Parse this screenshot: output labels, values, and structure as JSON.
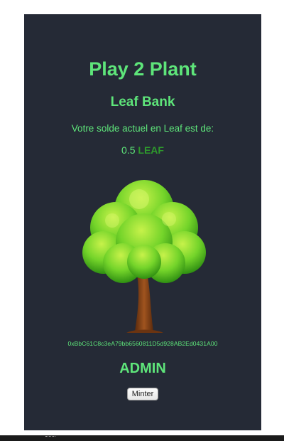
{
  "app": {
    "title": "Play 2 Plant",
    "subtitle": "Leaf Bank"
  },
  "balance": {
    "label": "Votre solde actuel en Leaf est de:",
    "amount": "0.5",
    "unit": "LEAF"
  },
  "tree_icon": "tree-illustration",
  "wallet": {
    "address": "0xBbC61C8c3eA79bb6560811D5d928AB2Ed0431A00"
  },
  "admin": {
    "heading": "ADMIN",
    "minter_label": "Minter"
  },
  "colors": {
    "background": "#252a36",
    "accent_green": "#5ee57a",
    "unit_green": "#2e9a2c"
  }
}
